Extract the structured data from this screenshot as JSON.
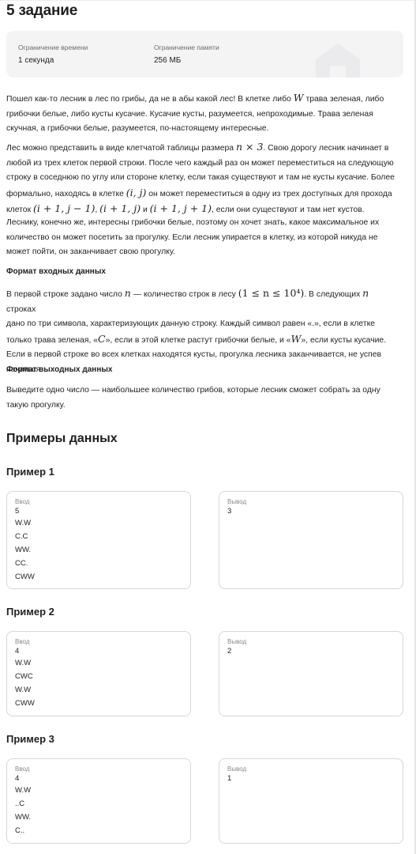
{
  "title": "5 задание",
  "limits": {
    "time_label": "Ограничение времени",
    "time_value": "1 секунда",
    "memory_label": "Ограничение памяти",
    "memory_value": "256 МБ"
  },
  "statement": {
    "p1_a": "Пошел как-то лесник в лес по грибы, да не в абы какой лес! В клетке либо ",
    "p1_m1": "W",
    "p1_b": " трава зеленая, либо",
    "p1_line2": "грибочки белые, либо кусты кусачие. Кусачие кусты, разумеется, непроходимые. Трава зеленая",
    "p1_line3": "скучная, а грибочки белые, разумеется, по-настоящему интересные.",
    "p2_a": "Лес можно представить в виде клетчатой таблицы размера ",
    "p2_m1": "n × 3",
    "p2_b": ". Свою дорогу лесник начинает в",
    "p2_line2": "любой из трех клеток первой строки. После чего каждый раз он может переместиться на следующую",
    "p2_line3": "строку в соседнюю по углу или стороне клетку, если такая существуют и там не кусты кусачие. Более",
    "p2_line4_a": "формально, находясь в клетке ",
    "p2_line4_m": "(i, j)",
    "p2_line4_b": " он может переместиться в одну из трех доступных для прохода",
    "p2_line5_a": "клеток ",
    "p2_line5_m1": "(i + 1, j − 1)",
    "p2_line5_sep1": ", ",
    "p2_line5_m2": "(i + 1, j)",
    "p2_line5_sep2": " и ",
    "p2_line5_m3": "(i + 1, j + 1)",
    "p2_line5_b": ", если они существуют и там нет кустов.",
    "p3_line1": "Леснику, конечно же, интересны грибочки белые, поэтому он хочет знать, какое максимальное их",
    "p3_line2": "количество он может посетить за прогулку. Если лесник упирается в клетку, из которой никуда не",
    "p3_line3": "может пойти, он заканчивает свою прогулку."
  },
  "input_format": {
    "heading": "Формат входных данных",
    "l1_a": "В первой строке задано число ",
    "l1_m1": "n",
    "l1_b": " — количество строк в лесу ",
    "l1_m2": "(1 ≤ n ≤ 10⁴)",
    "l1_c": ". В следующих ",
    "l1_m3": "n",
    "l1_d": " строках",
    "l2": "дано по три символа, характеризующих данную строку. Каждый символ равен «.», если в клетке",
    "l3_a": "только трава зеленая, «",
    "l3_m1": "C",
    "l3_b": "», если в этой клетке растут грибочки белые, и «",
    "l3_m2": "W",
    "l3_c": "», если кусты кусачие.",
    "l4": "Если в первой строке во всех клетках находятся кусты, прогулка лесника заканчивается, не успев",
    "l5": "начаться."
  },
  "output_format": {
    "heading": "Формат выходных данных",
    "l1": "Выведите одно число — наибольшее количество грибов, которые лесник сможет собрать за одну",
    "l2": "такую прогулку."
  },
  "examples_heading": "Примеры данных",
  "examples": [
    {
      "title": "Пример 1",
      "input_label": "Ввод",
      "input_lines": [
        "5",
        "W.W",
        "C.C",
        "WW.",
        "CC.",
        "CWW"
      ],
      "output_label": "Вывод",
      "output_lines": [
        "3"
      ]
    },
    {
      "title": "Пример 2",
      "input_label": "Ввод",
      "input_lines": [
        "4",
        "W.W",
        "CWC",
        "W.W",
        "CWW"
      ],
      "output_label": "Вывод",
      "output_lines": [
        "2"
      ]
    },
    {
      "title": "Пример 3",
      "input_label": "Ввод",
      "input_lines": [
        "4",
        "W.W",
        "..C",
        "WW.",
        "C.."
      ],
      "output_label": "Вывод",
      "output_lines": [
        "1"
      ]
    }
  ]
}
